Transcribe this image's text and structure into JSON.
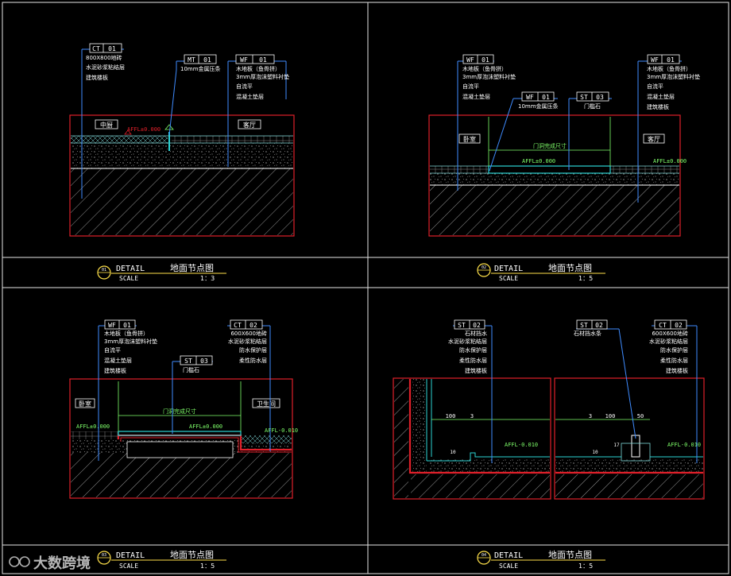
{
  "panels": [
    {
      "detail_no": "01",
      "detail_label": "DETAIL",
      "title": "地面节点图",
      "scale_label": "SCALE",
      "scale": "1：3",
      "tags": [
        {
          "code": "CT",
          "num": "01",
          "notes": [
            "800X800地砖",
            "水泥砂浆粘结层",
            "建筑楼板"
          ]
        },
        {
          "code": "MT",
          "num": "01",
          "notes": [
            "10mm金属压条"
          ]
        },
        {
          "code": "WF",
          "num": "01",
          "notes": [
            "木地板（鱼骨拼）",
            "3mm厚泡沫塑料衬垫",
            "自流平",
            "混凝土垫层"
          ]
        }
      ],
      "room_left": "中厨",
      "room_right": "客厅",
      "level": "AFFL±0.000"
    },
    {
      "detail_no": "02",
      "detail_label": "DETAIL",
      "title": "地面节点图",
      "scale_label": "SCALE",
      "scale": "1：5",
      "tags": [
        {
          "code": "WF",
          "num": "01",
          "notes": [
            "木地板（鱼骨拼）",
            "3mm厚泡沫塑料衬垫",
            "自流平",
            "混凝土垫层"
          ]
        },
        {
          "code": "WF",
          "num": "01",
          "notes": [
            "10mm金属压条"
          ]
        },
        {
          "code": "ST",
          "num": "03",
          "notes": [
            "门槛石"
          ]
        },
        {
          "code": "WF",
          "num": "01",
          "notes": [
            "木地板（鱼骨拼）",
            "3mm厚泡沫塑料衬垫",
            "自流平",
            "混凝土垫层",
            "建筑楼板"
          ]
        }
      ],
      "room_left": "卧室",
      "room_right": "客厅",
      "dim": "门洞完成尺寸",
      "level": "AFFL±0.000",
      "level2": "AFFL±0.000"
    },
    {
      "detail_no": "03",
      "detail_label": "DETAIL",
      "title": "地面节点图",
      "scale_label": "SCALE",
      "scale": "1：5",
      "tags": [
        {
          "code": "WF",
          "num": "01",
          "notes": [
            "木地板（鱼骨拼）",
            "3mm厚泡沫塑料衬垫",
            "自流平",
            "混凝土垫层",
            "建筑楼板"
          ]
        },
        {
          "code": "ST",
          "num": "03",
          "notes": [
            "门槛石"
          ]
        },
        {
          "code": "CT",
          "num": "02",
          "notes": [
            "600X600地砖",
            "水泥砂浆粘结层",
            "防水保护层",
            "柔性防水层"
          ]
        }
      ],
      "room_left": "卧室",
      "room_right": "卫生间",
      "dim": "门洞完成尺寸",
      "level": "AFFL±0.000",
      "level2": "AFFL±0.000",
      "level3": "AFFL-0.010"
    },
    {
      "detail_no": "04",
      "detail_label": "DETAIL",
      "title": "地面节点图",
      "scale_label": "SCALE",
      "scale": "1：5",
      "tags": [
        {
          "code": "ST",
          "num": "02",
          "notes": [
            "石材挡水",
            "水泥砂浆粘结层",
            "防水保护层",
            "柔性防水层",
            "建筑楼板"
          ]
        },
        {
          "code": "ST",
          "num": "02",
          "notes": [
            "石材挡水条"
          ]
        },
        {
          "code": "CT",
          "num": "02",
          "notes": [
            "600X600地砖",
            "水泥砂浆粘结层",
            "防水保护层",
            "柔性防水层",
            "建筑楼板"
          ]
        }
      ],
      "dims": [
        "100",
        "3",
        "3",
        "100",
        "50",
        "10",
        "17",
        "10"
      ],
      "level": "AFFL-0.010",
      "level2": "AFFL-0.010"
    }
  ],
  "watermark": "大数跨境"
}
